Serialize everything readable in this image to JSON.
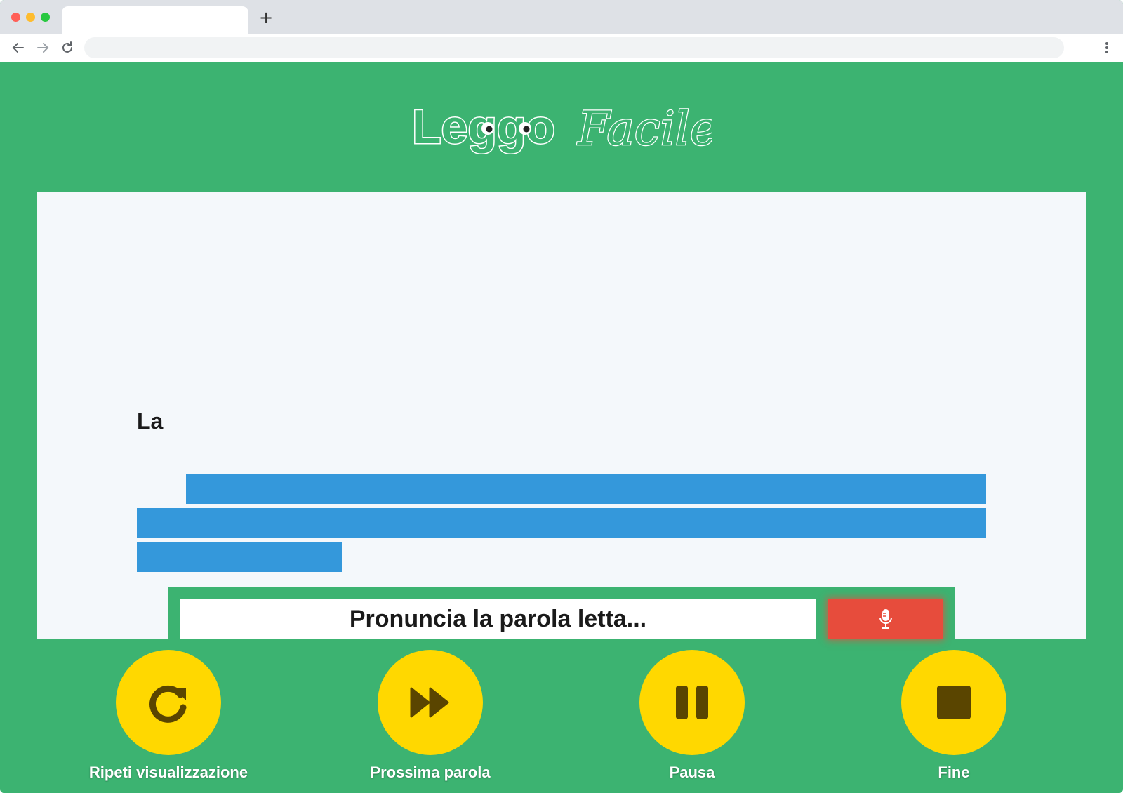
{
  "browser": {
    "tab_title": "",
    "new_tab": "+",
    "url": ""
  },
  "app": {
    "logo_part1": "Leggo",
    "logo_part2": "Facile"
  },
  "reading": {
    "first_word": "La",
    "hidden_lines": 3
  },
  "speech": {
    "prompt": "Pronuncia la parola letta...",
    "mic_icon": "microphone-icon"
  },
  "controls": [
    {
      "label": "Ripeti visualizzazione",
      "icon": "repeat-icon"
    },
    {
      "label": "Prossima parola",
      "icon": "fast-forward-icon"
    },
    {
      "label": "Pausa",
      "icon": "pause-icon"
    },
    {
      "label": "Fine",
      "icon": "stop-icon"
    }
  ],
  "colors": {
    "page_bg": "#3cb371",
    "reading_bg": "#f4f8fb",
    "hidden_bar": "#3498db",
    "mic_button": "#e74c3c",
    "control_button": "#ffd800",
    "control_icon": "#5a4500"
  }
}
